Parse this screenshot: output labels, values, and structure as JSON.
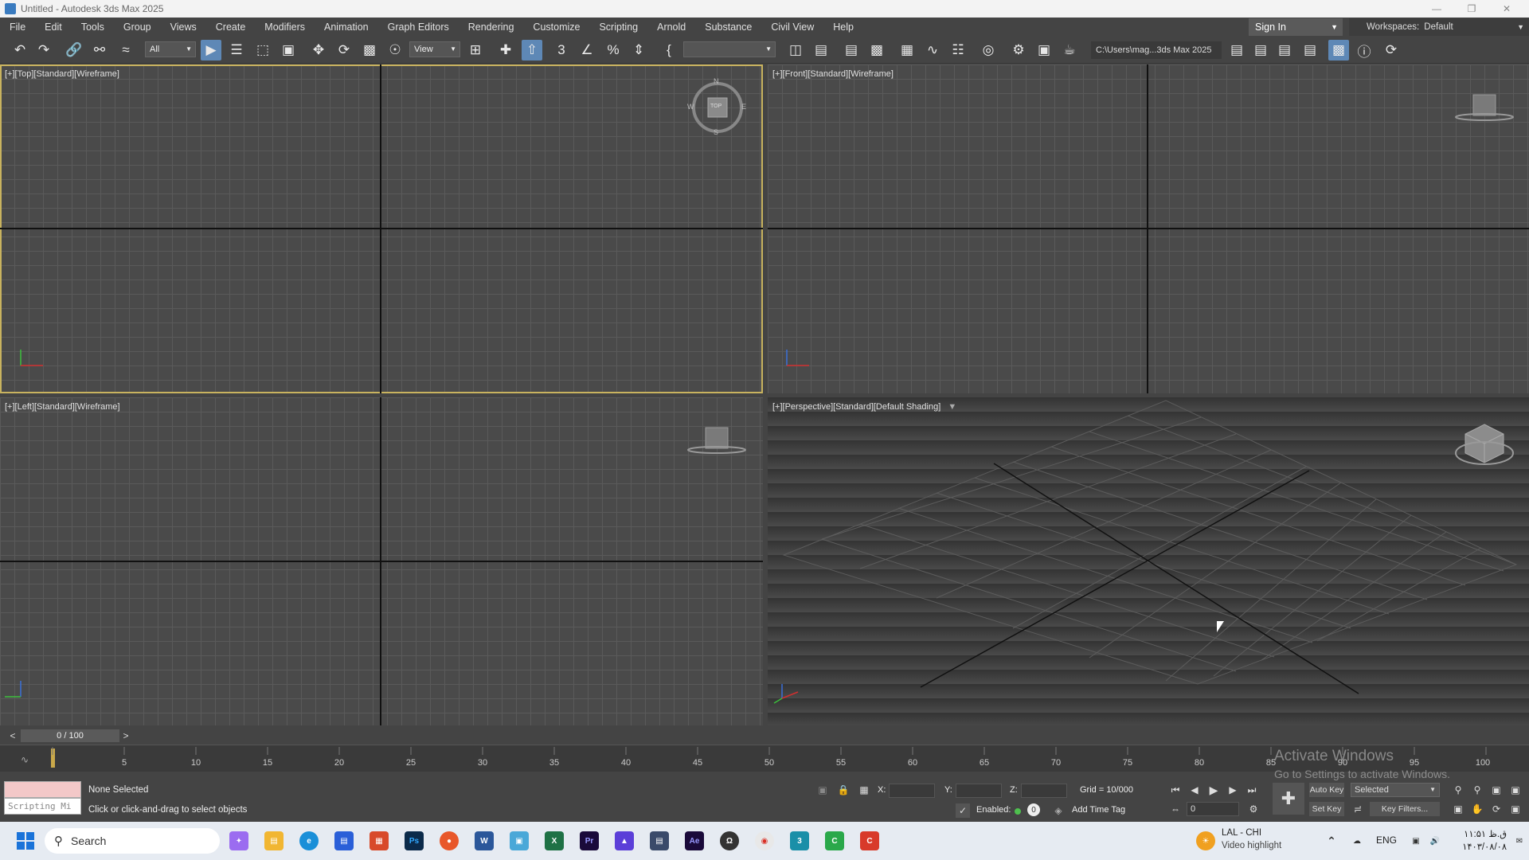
{
  "window": {
    "title": "Untitled - Autodesk 3ds Max 2025",
    "minimize_icon": "minimize-icon",
    "restore_icon": "restore-icon",
    "close_icon": "close-icon"
  },
  "menubar": {
    "items": [
      "File",
      "Edit",
      "Tools",
      "Group",
      "Views",
      "Create",
      "Modifiers",
      "Animation",
      "Graph Editors",
      "Rendering",
      "Customize",
      "Scripting",
      "Arnold",
      "Substance",
      "Civil View",
      "Help"
    ],
    "sign_in": "Sign In",
    "workspaces_label": "Workspaces:",
    "workspaces_value": "Default"
  },
  "toolbar": {
    "selection_filter": "All",
    "ref_coord": "View",
    "named_selection": "",
    "project_path": "C:\\Users\\mag...3ds Max 2025"
  },
  "viewports": {
    "top": "[+][Top][Standard][Wireframe]",
    "front": "[+][Front][Standard][Wireframe]",
    "left": "[+][Left][Standard][Wireframe]",
    "perspective": "[+][Perspective][Standard][Default Shading]",
    "compass": {
      "n": "N",
      "s": "S",
      "e": "E",
      "w": "W",
      "top_label": "TOP"
    }
  },
  "timeline": {
    "frame_display": "0 / 100",
    "prev_label": "<",
    "next_label": ">",
    "ticks": [
      "5",
      "10",
      "15",
      "20",
      "25",
      "30",
      "35",
      "40",
      "45",
      "50",
      "55",
      "60",
      "65",
      "70",
      "75",
      "80",
      "85",
      "90",
      "95",
      "100"
    ]
  },
  "status": {
    "script_placeholder": "Scripting Mi",
    "selection": "None Selected",
    "prompt": "Click or click-and-drag to select objects",
    "x_label": "X:",
    "y_label": "Y:",
    "z_label": "Z:",
    "grid": "Grid = 10/000",
    "enabled_label": "Enabled:",
    "enabled_value": "0",
    "add_time_tag": "Add Time Tag",
    "auto_key": "Auto Key",
    "set_key": "Set Key",
    "key_mode": "Selected",
    "key_filters": "Key Filters...",
    "current_frame": "0"
  },
  "watermark": {
    "line1": "Activate Windows",
    "line2": "Go to Settings to activate Windows."
  },
  "taskbar": {
    "search_placeholder": "Search",
    "weather_title": "LAL - CHI",
    "weather_sub": "Video highlight",
    "lang": "ENG",
    "time": "ق.ظ ۱۱:۵۱",
    "date": "۱۴۰۳/۰۸/۰۸"
  }
}
